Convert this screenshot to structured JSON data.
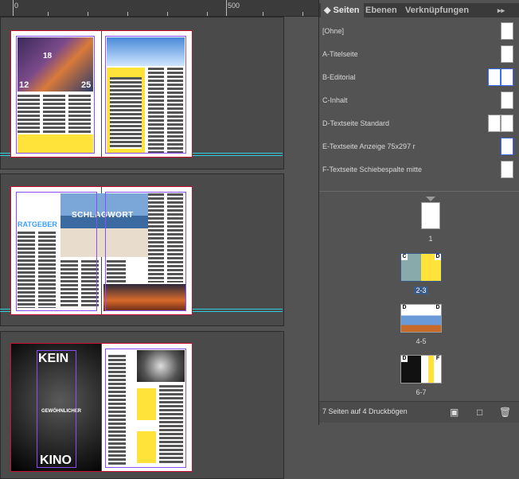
{
  "ruler": {
    "labels": [
      "0",
      "500"
    ]
  },
  "spreads_art": {
    "spread1": {
      "numbers": [
        "18",
        "12",
        "25"
      ]
    },
    "spread2": {
      "headline": "SCHLAGWORT",
      "section": "RATGEBER"
    },
    "spread3": {
      "word_top": "KEIN",
      "word_bottom": "KINO",
      "subline": "GEWÖHNLICHER"
    }
  },
  "panel": {
    "tabs": [
      {
        "label": "Seiten",
        "active": true
      },
      {
        "label": "Ebenen",
        "active": false
      },
      {
        "label": "Verknüpfungen",
        "active": false
      }
    ],
    "menu_glyph": "▸▸",
    "masters": [
      {
        "label": "[Ohne]"
      },
      {
        "label": "A-Titelseite"
      },
      {
        "label": "B-Editorial"
      },
      {
        "label": "C-Inhalt"
      },
      {
        "label": "D-Textseite Standard"
      },
      {
        "label": "E-Textseite Anzeige 75x297 r"
      },
      {
        "label": "F-Textseite Schiebespalte mitte"
      }
    ],
    "pages": [
      {
        "label": "1",
        "selected": false
      },
      {
        "label": "2-3",
        "selected": true
      },
      {
        "label": "4-5",
        "selected": false
      },
      {
        "label": "6-7",
        "selected": false
      }
    ],
    "badges": [
      "C",
      "D",
      "D",
      "D",
      "D",
      "F"
    ],
    "footer_text": "7 Seiten auf 4 Druckbögen"
  },
  "colors": {
    "accent_yellow": "#ffe33a",
    "frame_purple": "#8a4cff",
    "guide_cyan": "#2fd0e0",
    "selection": "#3b5b8a"
  }
}
